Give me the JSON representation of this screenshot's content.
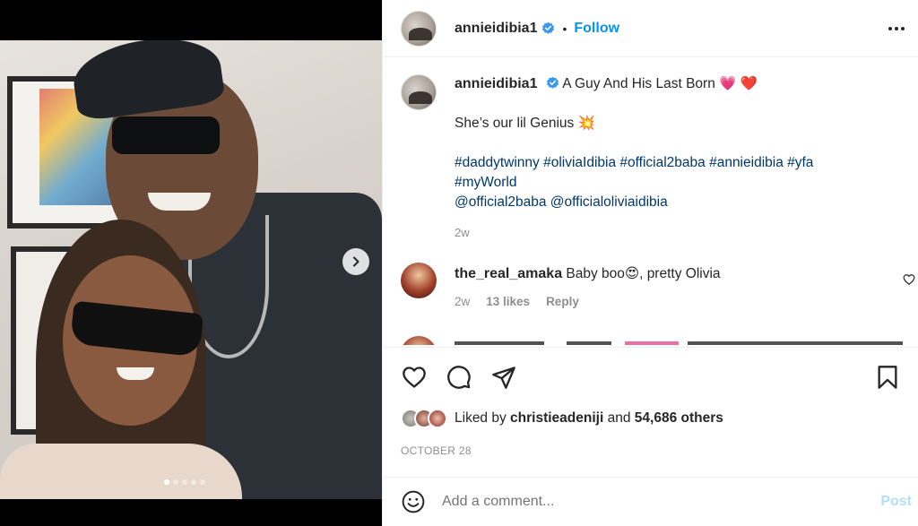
{
  "post": {
    "username": "annieidibia1",
    "verified": true,
    "separator": "•",
    "follow_label": "Follow",
    "caption": {
      "title_text": "A Guy And His Last Born",
      "title_emojis": "💗 ❤️",
      "line2_text": "She’s our lil Genius",
      "line2_emoji": "💥",
      "hashtags_line1": "#daddytwinny #oliviaIdibia #official2baba #annieidibia #yfa",
      "hashtags_line2": "#myWorld",
      "mentions": "@official2baba @officialoliviaidibia",
      "time": "2w"
    },
    "comments": [
      {
        "username": "the_real_amaka",
        "text_before": "Baby boo",
        "emoji": "😍",
        "text_after": ", pretty Olivia",
        "time": "2w",
        "likes": "13 likes",
        "reply_label": "Reply"
      }
    ],
    "liked_by": {
      "prefix": "Liked by",
      "user": "christieadeniji",
      "mid": "and",
      "count": "54,686 others"
    },
    "date": "OCTOBER 28",
    "add_comment": {
      "placeholder": "Add a comment...",
      "post_label": "Post"
    },
    "carousel": {
      "current": 1,
      "total": 5
    }
  },
  "colors": {
    "accent": "#0095f6",
    "hashtag": "#00376b",
    "muted": "#8e8e8e",
    "post_disabled": "#b2dffc"
  },
  "icons": [
    "verified-badge-icon",
    "more-options-icon",
    "next-arrow-icon",
    "heart-icon",
    "comment-icon",
    "share-icon",
    "bookmark-icon",
    "emoji-icon"
  ]
}
